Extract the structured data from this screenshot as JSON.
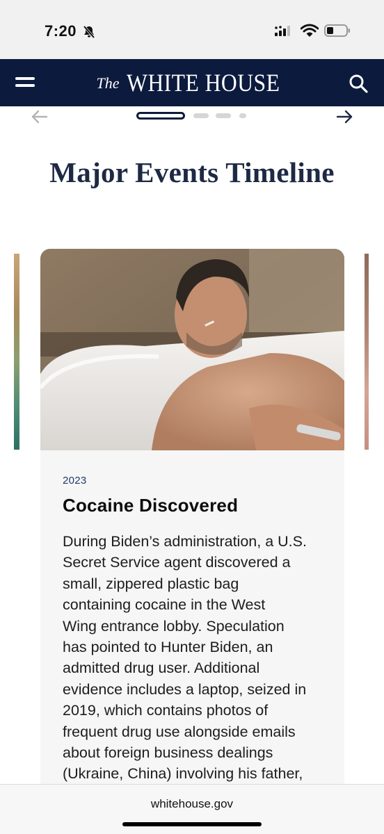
{
  "status_bar": {
    "time": "7:20"
  },
  "header": {
    "brand_prefix": "The",
    "brand_name": "WHITE HOUSE",
    "background_color": "#0c1a3d"
  },
  "carousel": {
    "prev_icon": "arrow-left-icon",
    "next_icon": "arrow-right-icon",
    "active_index": 1,
    "total_dots": 4
  },
  "page": {
    "title": "Major Events Timeline"
  },
  "card": {
    "year": "2023",
    "heading": "Cocaine Discovered",
    "body_lines": [
      "During Biden’s administration, a U.S.",
      "Secret Service agent discovered a",
      "small, zippered plastic bag",
      "containing cocaine in the West",
      "Wing entrance lobby. Speculation",
      "has pointed to Hunter Biden, an",
      "admitted drug user. Additional",
      "evidence includes a laptop, seized in",
      "2019, which contains photos of",
      "frequent drug use alongside emails",
      "about foreign business dealings",
      "(Ukraine, China) involving his father,"
    ]
  },
  "browser": {
    "url": "whitehouse.gov"
  }
}
